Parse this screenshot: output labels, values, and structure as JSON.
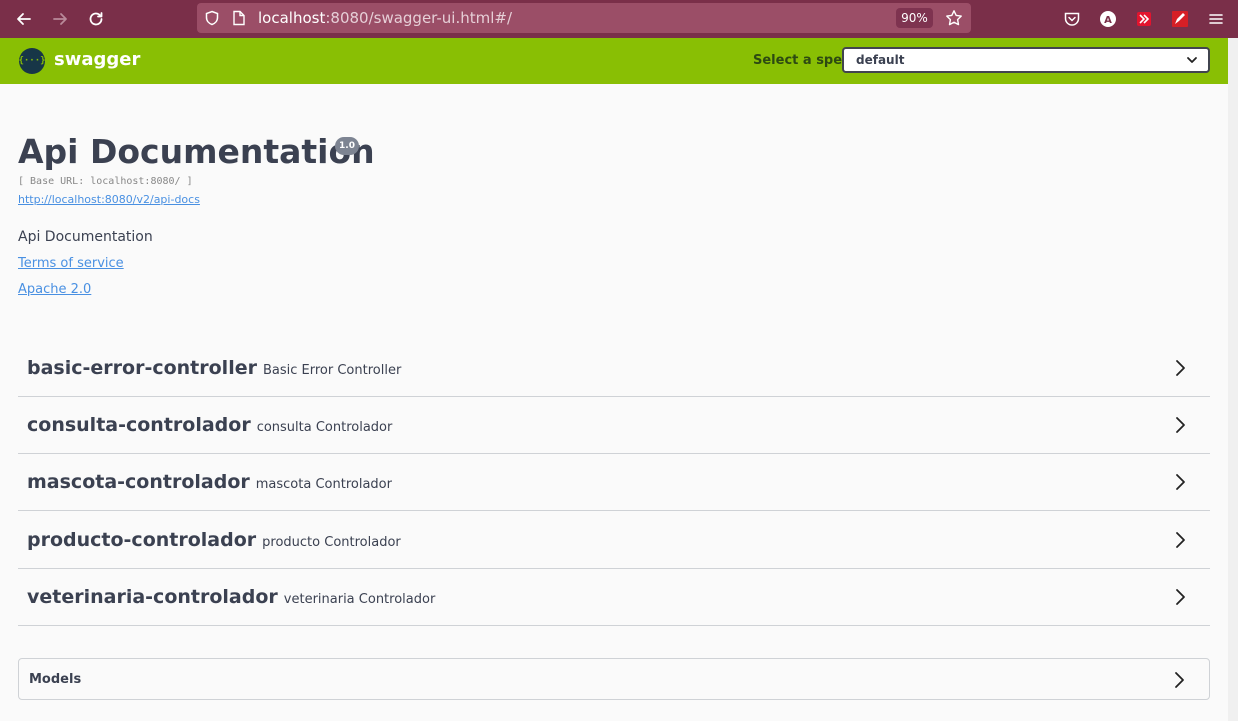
{
  "browser": {
    "url_host": "localhost",
    "url_rest": ":8080/swagger-ui.html#/",
    "zoom": "90%"
  },
  "header": {
    "logo_text": "swagger",
    "logo_glyph": "{···}",
    "spec_label": "Select a spec",
    "spec_value": "default"
  },
  "info": {
    "title": "Api Documentation",
    "version": "1.0",
    "base_url": "[ Base URL: localhost:8080/ ]",
    "api_docs_link": "http://localhost:8080/v2/api-docs",
    "description": "Api Documentation",
    "terms_link": "Terms of service",
    "license_link": "Apache 2.0"
  },
  "tags": [
    {
      "name": "basic-error-controller",
      "description": "Basic Error Controller"
    },
    {
      "name": "consulta-controlador",
      "description": "consulta Controlador"
    },
    {
      "name": "mascota-controlador",
      "description": "mascota Controlador"
    },
    {
      "name": "producto-controlador",
      "description": "producto Controlador"
    },
    {
      "name": "veterinaria-controlador",
      "description": "veterinaria Controlador"
    }
  ],
  "models": {
    "label": "Models"
  },
  "colors": {
    "browser_bar": "#7a2f49",
    "swagger_green": "#89bf04",
    "text_dark": "#3b4151",
    "link_blue": "#4990e2"
  },
  "icons": [
    "back-arrow-icon",
    "forward-arrow-icon",
    "reload-icon",
    "shield-icon",
    "page-icon",
    "star-icon",
    "pocket-icon",
    "account-icon",
    "extension-red-icon",
    "extension-pen-icon",
    "menu-icon",
    "chevron-down-icon",
    "chevron-right-icon"
  ]
}
